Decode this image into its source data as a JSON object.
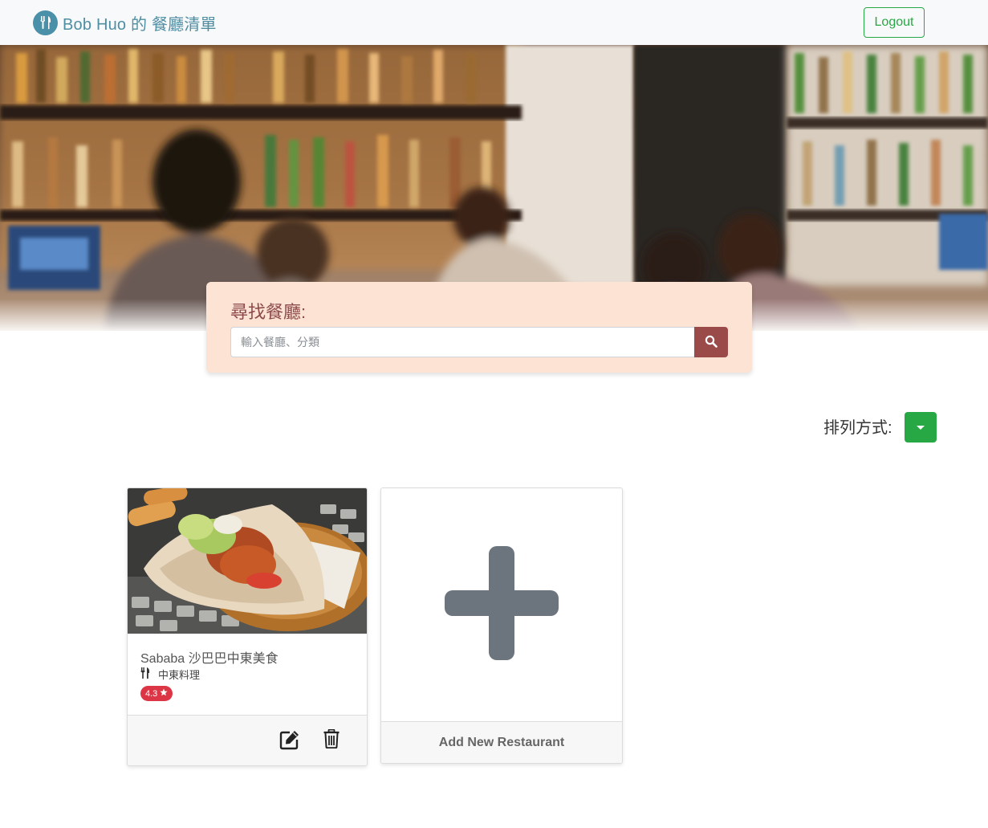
{
  "navbar": {
    "brand_text": "Bob Huo 的 餐廳清單",
    "logout_label": "Logout"
  },
  "search": {
    "title": "尋找餐廳:",
    "placeholder": "輸入餐廳、分類"
  },
  "sort": {
    "label": "排列方式:"
  },
  "restaurants": [
    {
      "name": "Sababa 沙巴巴中東美食",
      "category": "中東料理",
      "rating": "4.3"
    }
  ],
  "add_card": {
    "label": "Add New Restaurant"
  },
  "colors": {
    "brand": "#4f8ea3",
    "success": "#28a745",
    "search_bg": "#fde3d4",
    "search_btn": "#9b4a4a",
    "rating_badge": "#dc3545"
  }
}
